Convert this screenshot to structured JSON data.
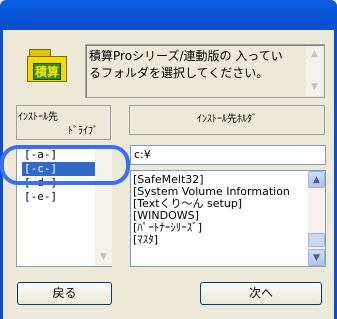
{
  "dialog": {
    "message_line1": "積算Proシリーズ/連動版の 入ってい",
    "message_line2": "るフォルダを選択してください。",
    "icon_label": "積算"
  },
  "drive_panel": {
    "header_line1": "ｲﾝｽﾄｰﾙ先",
    "header_line2": "ﾄﾞﾗｲﾌﾞ",
    "items": [
      {
        "label": "[-a-]",
        "selected": false
      },
      {
        "label": "[-c-]",
        "selected": true
      },
      {
        "label": "[-d-]",
        "selected": false
      },
      {
        "label": "[-e-]",
        "selected": false
      }
    ]
  },
  "folder_panel": {
    "header": "ｲﾝｽﾄｰﾙ先ﾎﾙﾀﾞ",
    "path_value": "c:¥",
    "items": [
      "[SafeMelt32]",
      "[System Volume Information",
      "[Textくり〜ん setup]",
      "[WINDOWS]",
      "[ﾊﾟｰﾄﾅｰｼﾘｰｽﾞ]",
      "[ﾏｽﾀ]"
    ]
  },
  "buttons": {
    "back": "戻る",
    "next": "次へ"
  },
  "icons": {
    "app": "folder-app-icon",
    "scroll_up": "chevron-up-icon",
    "scroll_down": "chevron-down-icon"
  },
  "colors": {
    "titlebar": "#0a5ee6",
    "selection": "#316ac5",
    "highlight_ring": "#3a6ff0"
  }
}
